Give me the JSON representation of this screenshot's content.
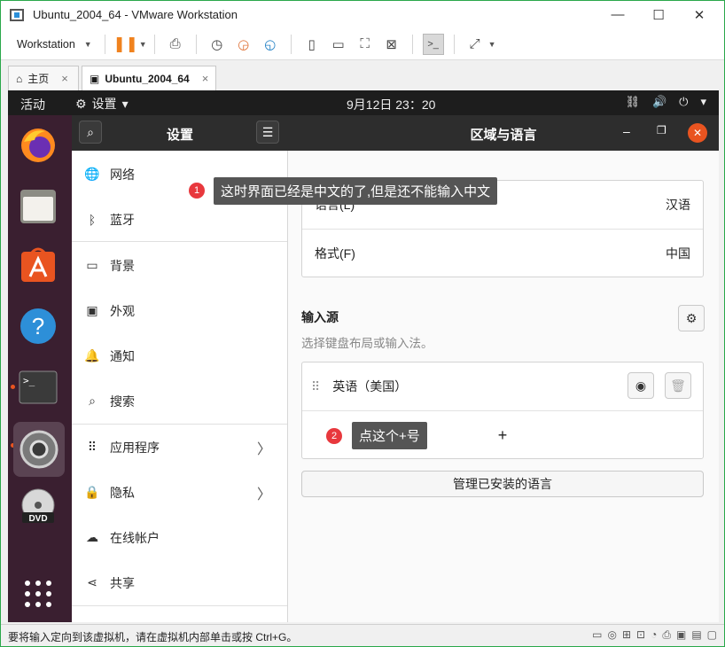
{
  "window": {
    "title": "Ubuntu_2004_64 - VMware Workstation",
    "minimize": "—",
    "maximize": "☐",
    "close": "✕"
  },
  "toolbar": {
    "menu_label": "Workstation",
    "menu_caret": "▼"
  },
  "tabs": [
    {
      "icon": "⌂",
      "label": "主页",
      "close": "×"
    },
    {
      "icon": "▣",
      "label": "Ubuntu_2004_64",
      "close": "×"
    }
  ],
  "ubuntu": {
    "activities": "活动",
    "app_menu": "设置",
    "app_menu_caret": "▾",
    "clock": "9月12日  23：20",
    "tray": {
      "network": "⛓",
      "volume": "🔊",
      "power": "⏻",
      "caret": "▾"
    }
  },
  "dock": {
    "items": [
      "firefox-icon",
      "files-icon",
      "software-icon",
      "help-icon",
      "terminal-icon",
      "settings-icon",
      "dvd-icon",
      "app-grid-icon"
    ],
    "terminal_glyph": ">_",
    "help_glyph": "?",
    "dvd_text": "DVD"
  },
  "settings": {
    "sidebar_title": "设置",
    "items": [
      {
        "icon": "🌐",
        "label": "网络"
      },
      {
        "icon": "ᛒ",
        "label": "蓝牙"
      },
      {
        "icon": "▭",
        "label": "背景"
      },
      {
        "icon": "▣",
        "label": "外观"
      },
      {
        "icon": "🔔",
        "label": "通知"
      },
      {
        "icon": "⌕",
        "label": "搜索"
      },
      {
        "icon": "⠿",
        "label": "应用程序",
        "chevron": "〉"
      },
      {
        "icon": "🔒",
        "label": "隐私",
        "chevron": "〉"
      },
      {
        "icon": "☁",
        "label": "在线帐户"
      },
      {
        "icon": "⋖",
        "label": "共享"
      }
    ]
  },
  "region": {
    "title": "区域与语言",
    "win_min": "–",
    "win_max": "❐",
    "win_close": "✕",
    "language_label": "语言(L)",
    "language_value": "汉语",
    "format_label": "格式(F)",
    "format_value": "中国",
    "input_sources_heading": "输入源",
    "input_sources_desc": "选择键盘布局或输入法。",
    "source_name": "英语（美国）",
    "add_symbol": "+",
    "manage_button": "管理已安装的语言"
  },
  "annotations": {
    "note1_num": "1",
    "note1_text": "这时界面已经是中文的了,但是还不能输入中文",
    "note2_num": "2",
    "note2_text": "点这个+号"
  },
  "statusbar": {
    "message": "要将输入定向到该虚拟机，请在虚拟机内部单击或按 Ctrl+G。"
  }
}
